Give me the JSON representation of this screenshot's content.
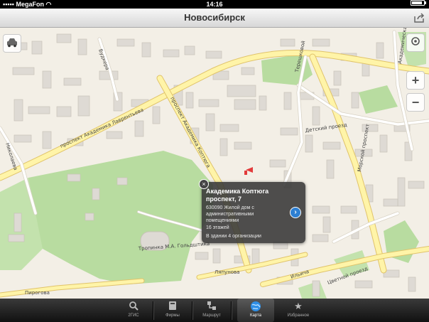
{
  "status_bar": {
    "carrier": "MegaFon",
    "time": "14:16",
    "battery": "100 %"
  },
  "nav": {
    "title": "Новосибирск"
  },
  "map": {
    "streets": [
      "проспект Академика Лаврентьева",
      "Николаева",
      "Пирогова",
      "Будкера",
      "проспект Академика Коптюга",
      "Терешковой",
      "Детский проезд",
      "Морской проспект",
      "Тропинка М.А. Гольдштика",
      "Ляпунова",
      "Ильича",
      "Цветной проезд",
      "Академическая"
    ],
    "colors": {
      "park": "#b8dca0",
      "road_fill": "#fff4a8",
      "road_edge": "#e0c36a",
      "building": "#dedad4",
      "building_edge": "#c8c2b8",
      "land": "#f3efe6"
    }
  },
  "controls": {
    "zoom_in": "+",
    "zoom_out": "−"
  },
  "popup": {
    "title": "Академика Коптюга проспект, 7",
    "lines": [
      "630090 Жилой дом с",
      "административными",
      "помещениями",
      "16 этажей",
      "В здании 4 организации"
    ],
    "close": "×",
    "more": "›"
  },
  "tabs": [
    {
      "label": "2ГИС",
      "icon": "search-icon"
    },
    {
      "label": "Фирмы",
      "icon": "book-icon"
    },
    {
      "label": "Маршрут",
      "icon": "route-icon"
    },
    {
      "label": "Карта",
      "icon": "globe-icon",
      "active": true
    },
    {
      "label": "Избранное",
      "icon": "star-icon"
    }
  ]
}
